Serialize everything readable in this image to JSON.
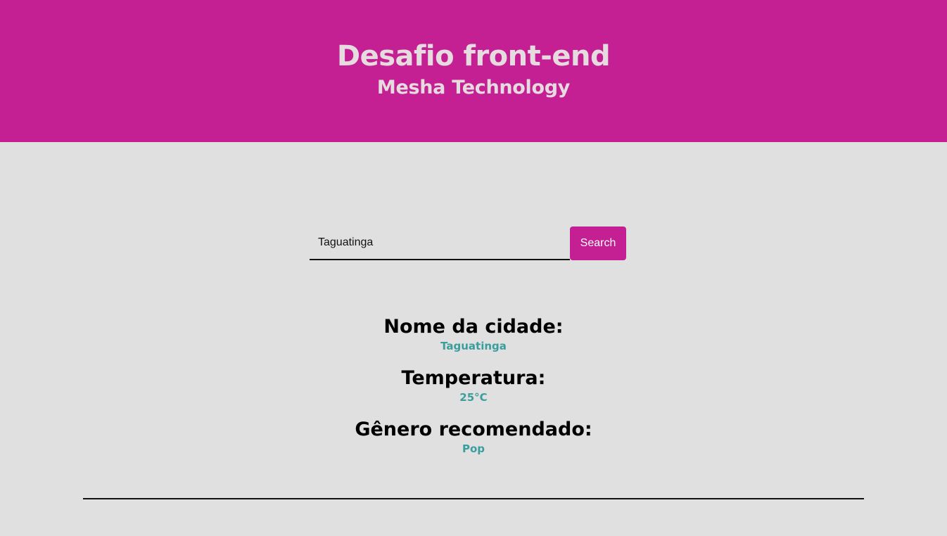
{
  "header": {
    "title": "Desafio front-end",
    "subtitle": "Mesha Technology"
  },
  "search": {
    "value": "Taguatinga",
    "button_label": "Search"
  },
  "results": {
    "city_label": "Nome da cidade:",
    "city_value": "Taguatinga",
    "temperature_label": "Temperatura:",
    "temperature_value": "25°C",
    "genre_label": "Gênero recomendado:",
    "genre_value": "Pop"
  },
  "colors": {
    "brand": "#c41f93",
    "background": "#e0e0e0",
    "accent_value": "#3a9e9e"
  }
}
